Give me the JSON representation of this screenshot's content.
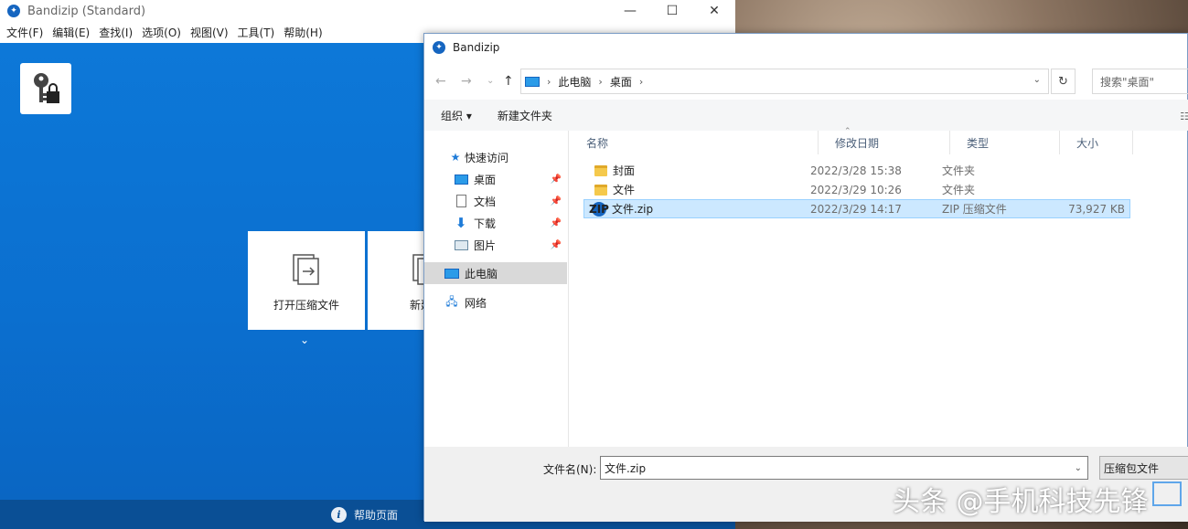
{
  "main_window": {
    "title": "Bandizip (Standard)",
    "controls": [
      "—",
      "☐",
      "✕"
    ],
    "menu": [
      "文件(F)",
      "编辑(E)",
      "查找(I)",
      "选项(O)",
      "视图(V)",
      "工具(T)",
      "帮助(H)"
    ],
    "tiles": [
      {
        "label": "打开压缩文件"
      },
      {
        "label": "新建压"
      }
    ],
    "chevron": "⌄",
    "footer_help": "帮助页面"
  },
  "dialog": {
    "title": "Bandizip",
    "nav": {
      "back": "←",
      "forward": "→",
      "recent": "⌄",
      "up": "↑"
    },
    "breadcrumb": [
      "此电脑",
      "桌面"
    ],
    "search_placeholder": "搜索\"桌面\"",
    "toolbar": {
      "organize": "组织 ▾",
      "new_folder": "新建文件夹"
    },
    "sidebar": [
      {
        "label": "快速访问",
        "icon": "star-icon"
      },
      {
        "label": "桌面",
        "icon": "desktop-icon",
        "pinned": true
      },
      {
        "label": "文档",
        "icon": "document-icon",
        "pinned": true
      },
      {
        "label": "下载",
        "icon": "download-icon",
        "pinned": true
      },
      {
        "label": "图片",
        "icon": "picture-icon",
        "pinned": true
      },
      {
        "label": "此电脑",
        "icon": "computer-icon",
        "selected": true
      },
      {
        "label": "网络",
        "icon": "network-icon"
      }
    ],
    "columns": {
      "name": "名称",
      "date": "修改日期",
      "type": "类型",
      "size": "大小"
    },
    "files": [
      {
        "name": "封面",
        "date": "2022/3/28 15:38",
        "type": "文件夹",
        "size": ""
      },
      {
        "name": "文件",
        "date": "2022/3/29 10:26",
        "type": "文件夹",
        "size": ""
      },
      {
        "name": "文件.zip",
        "date": "2022/3/29 14:17",
        "type": "ZIP 压缩文件",
        "size": "73,927 KB"
      }
    ],
    "filename_label": "文件名(N):",
    "filename_value": "文件.zip",
    "filetype": "压缩包文件"
  },
  "watermark": "头条 @手机科技先锋"
}
